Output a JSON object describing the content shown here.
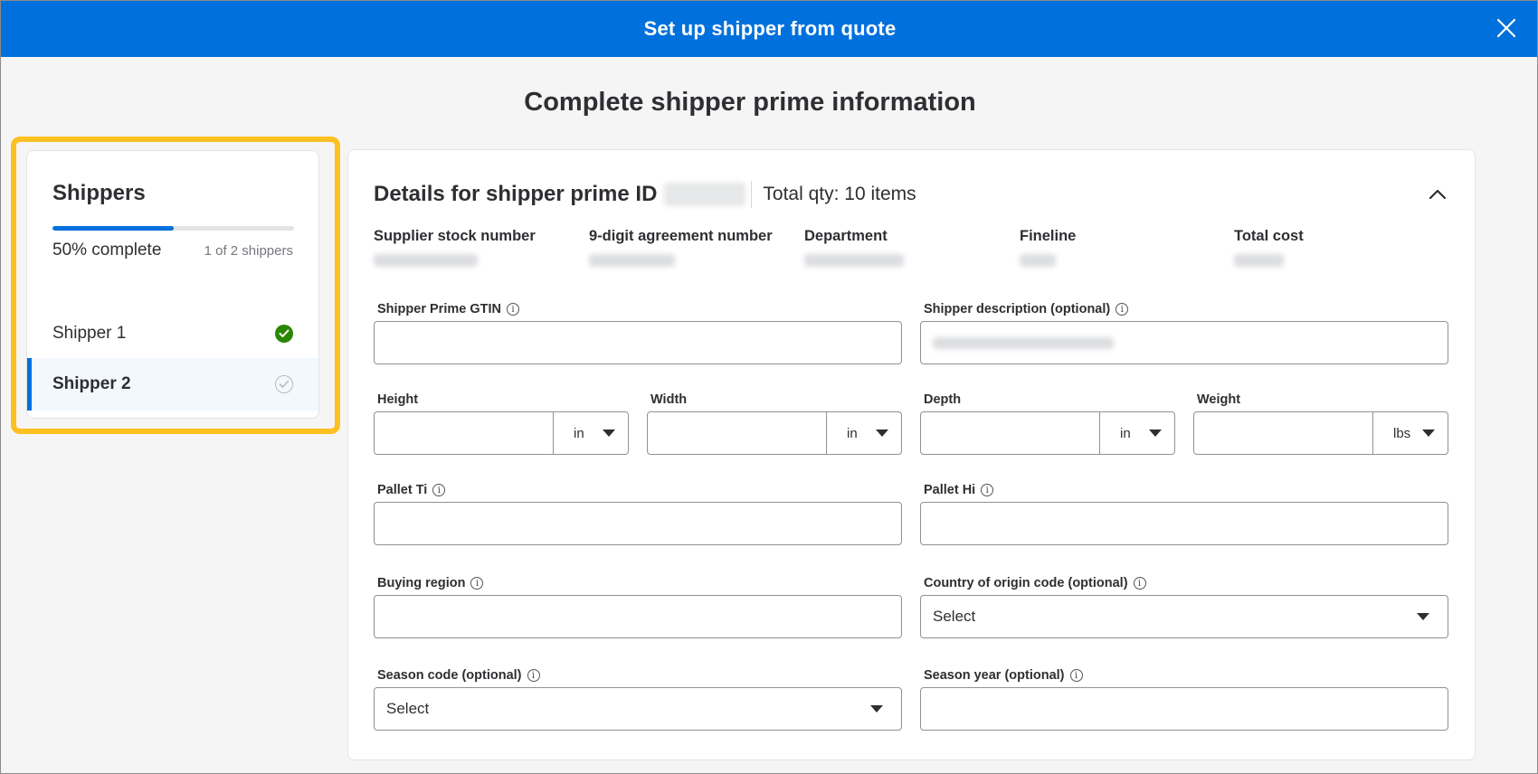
{
  "header": {
    "title": "Set up shipper from quote"
  },
  "page": {
    "title": "Complete shipper prime information"
  },
  "sidebar": {
    "title": "Shippers",
    "progress_percent": 50,
    "progress_text": "50% complete",
    "count_text": "1 of 2 shippers",
    "items": [
      {
        "label": "Shipper 1",
        "status": "complete"
      },
      {
        "label": "Shipper 2",
        "status": "pending",
        "active": true
      }
    ]
  },
  "details": {
    "heading": "Details for shipper prime ID",
    "total_qty": "Total qty: 10 items",
    "meta": [
      {
        "label": "Supplier stock number"
      },
      {
        "label": "9-digit agreement number"
      },
      {
        "label": "Department"
      },
      {
        "label": "Fineline"
      },
      {
        "label": "Total cost"
      }
    ]
  },
  "form": {
    "gtin_label": "Shipper Prime GTIN",
    "description_label": "Shipper description (optional)",
    "height_label": "Height",
    "height_unit": "in",
    "width_label": "Width",
    "width_unit": "in",
    "depth_label": "Depth",
    "depth_unit": "in",
    "weight_label": "Weight",
    "weight_unit": "lbs",
    "pallet_ti_label": "Pallet Ti",
    "pallet_hi_label": "Pallet Hi",
    "buying_region_label": "Buying region",
    "country_label": "Country of origin code (optional)",
    "country_value": "Select",
    "season_code_label": "Season code (optional)",
    "season_code_value": "Select",
    "season_year_label": "Season year (optional)"
  },
  "colors": {
    "brand": "#0071dc",
    "highlight": "#fcc020",
    "success": "#2a8703"
  }
}
